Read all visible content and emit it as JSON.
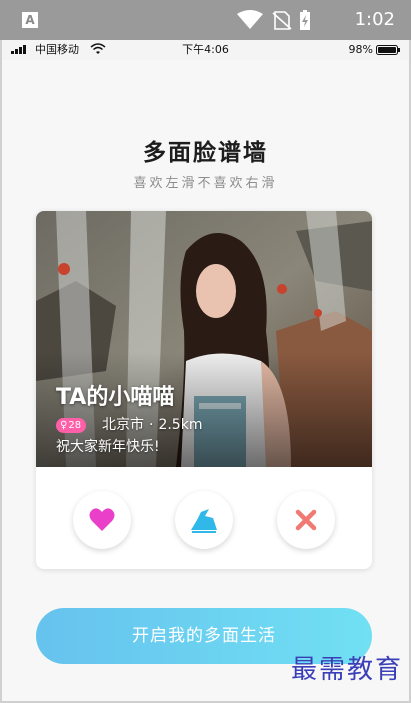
{
  "system_bar": {
    "app_badge": "A",
    "time": "1:02"
  },
  "status_bar": {
    "carrier": "中国移动",
    "time": "下午4:06",
    "battery": "98%"
  },
  "page": {
    "title": "多面脸谱墙",
    "subtitle": "喜欢左滑不喜欢右滑"
  },
  "card": {
    "name": "TA的小喵喵",
    "age": "28",
    "gender_symbol": "♀",
    "city": "北京市",
    "separator": "·",
    "distance": "2.5km",
    "greeting": "祝大家新年快乐!"
  },
  "actions": {
    "like_icon": "heart-icon",
    "gift_icon": "gift-icon",
    "pass_icon": "close-icon"
  },
  "cta": {
    "label": "开启我的多面生活"
  },
  "watermark": {
    "text": "最需教育"
  },
  "colors": {
    "like": "#e93fc9",
    "gift": "#2fb8e8",
    "pass": "#f07a72",
    "badge": "#ff5fa8",
    "cta_start": "#66c2ee",
    "cta_end": "#71e0f3"
  }
}
